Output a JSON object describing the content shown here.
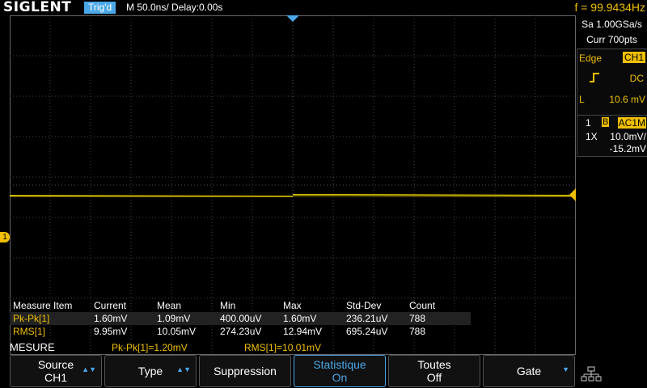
{
  "header": {
    "brand": "SIGLENT",
    "trigger_status": "Trig'd",
    "timebase": "M 50.0ns/",
    "delay": "Delay:0.00s",
    "frequency": "f = 99.9434Hz"
  },
  "acquisition": {
    "sample_rate": "Sa 1.00GSa/s",
    "points": "Curr 700pts"
  },
  "trigger": {
    "type": "Edge",
    "source": "CH1",
    "coupling": "DC",
    "level_prefix": "L",
    "level": "10.6 mV",
    "slope_icon": "rising-edge-icon"
  },
  "channel": {
    "number": "1",
    "bw_flag": "B",
    "coupling": "AC1M",
    "probe": "1X",
    "scale": "10.0mV/",
    "offset": "-15.2mV",
    "marker": "1"
  },
  "measure_table": {
    "headers": [
      "Measure Item",
      "Current",
      "Mean",
      "Min",
      "Max",
      "Std-Dev",
      "Count"
    ],
    "rows": [
      [
        "Pk-Pk[1]",
        "1.60mV",
        "1.09mV",
        "400.00uV",
        "1.60mV",
        "236.21uV",
        "788"
      ],
      [
        "RMS[1]",
        "9.95mV",
        "10.05mV",
        "274.23uV",
        "12.94mV",
        "695.24uV",
        "788"
      ]
    ]
  },
  "menu": {
    "title": "MESURE",
    "pkpk_summary": "Pk-Pk[1]=1.20mV",
    "rms_summary": "RMS[1]=10.01mV",
    "softkeys": [
      {
        "l1": "Source",
        "l2": "CH1"
      },
      {
        "l1": "Type",
        "l2": ""
      },
      {
        "l1": "Suppression",
        "l2": ""
      },
      {
        "l1": "Statistique",
        "l2": "On"
      },
      {
        "l1": "Toutes",
        "l2": "Off"
      },
      {
        "l1": "Gate",
        "l2": ""
      }
    ]
  },
  "colors": {
    "channel1": "#f0c000",
    "accent": "#4aa7e8",
    "background": "#000000"
  }
}
